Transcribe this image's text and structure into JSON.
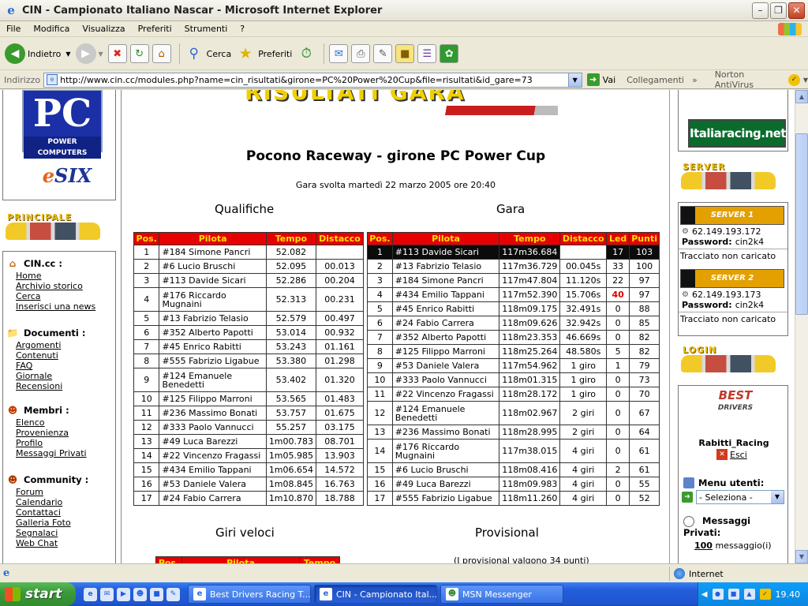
{
  "window": {
    "title": "CIN - Campionato Italiano Nascar - Microsoft Internet Explorer"
  },
  "menu": [
    "File",
    "Modifica",
    "Visualizza",
    "Preferiti",
    "Strumenti",
    "?"
  ],
  "toolbar": {
    "back": "Indietro",
    "search": "Cerca",
    "favorites": "Preferiti"
  },
  "address": {
    "label": "Indirizzo",
    "url": "http://www.cin.cc/modules.php?name=cin_risultati&girone=PC%20Power%20Cup&file=risultati&id_gare=73",
    "go": "Vai",
    "links": "Collegamenti",
    "antivirus": "Norton AntiVirus"
  },
  "left": {
    "pc_logo_big": "PC",
    "pc_logo_small": "POWER COMPUTERS",
    "esix_a": "e",
    "esix_b": "SIX",
    "principale": "PRINCIPALE",
    "sections": [
      {
        "title": "CIN.cc :",
        "icon": "home-icon",
        "links": [
          "Home",
          "Archivio storico",
          "Cerca",
          "Inserisci una news"
        ]
      },
      {
        "title": "Documenti :",
        "icon": "folder-icon",
        "links": [
          "Argomenti",
          "Contenuti",
          "FAQ",
          "Giornale",
          "Recensioni"
        ]
      },
      {
        "title": "Membri :",
        "icon": "users-icon",
        "links": [
          "Elenco",
          "Provenienza",
          "Profilo",
          "Messaggi Privati"
        ]
      },
      {
        "title": "Community :",
        "icon": "community-icon",
        "links": [
          "Forum",
          "Calendario",
          "Contattaci",
          "Galleria Foto",
          "Segnalaci",
          "Web Chat"
        ]
      }
    ]
  },
  "main": {
    "banner": "RISULTATI GARA",
    "race_title": "Pocono Raceway - girone PC Power Cup",
    "race_date": "Gara svolta martedì 22 marzo 2005 ore 20:40",
    "qual_title": "Qualifiche",
    "race_section": "Gara",
    "fast_laps": "Giri veloci",
    "provisional": "Provisional",
    "provisional_note": "(I provisional valgono 34 punti)",
    "qual_headers": [
      "Pos.",
      "Pilota",
      "Tempo",
      "Distacco"
    ],
    "qual_rows": [
      [
        "1",
        "#184 Simone Pancri",
        "52.082",
        ""
      ],
      [
        "2",
        "#6 Lucio Bruschi",
        "52.095",
        "00.013"
      ],
      [
        "3",
        "#113 Davide Sicari",
        "52.286",
        "00.204"
      ],
      [
        "4",
        "#176 Riccardo Mugnaini",
        "52.313",
        "00.231"
      ],
      [
        "5",
        "#13 Fabrizio Telasio",
        "52.579",
        "00.497"
      ],
      [
        "6",
        "#352 Alberto Papotti",
        "53.014",
        "00.932"
      ],
      [
        "7",
        "#45 Enrico Rabitti",
        "53.243",
        "01.161"
      ],
      [
        "8",
        "#555 Fabrizio Ligabue",
        "53.380",
        "01.298"
      ],
      [
        "9",
        "#124 Emanuele Benedetti",
        "53.402",
        "01.320"
      ],
      [
        "10",
        "#125 Filippo Marroni",
        "53.565",
        "01.483"
      ],
      [
        "11",
        "#236 Massimo Bonati",
        "53.757",
        "01.675"
      ],
      [
        "12",
        "#333 Paolo Vannucci",
        "55.257",
        "03.175"
      ],
      [
        "13",
        "#49 Luca Barezzi",
        "1m00.783",
        "08.701"
      ],
      [
        "14",
        "#22 Vincenzo Fragassi",
        "1m05.985",
        "13.903"
      ],
      [
        "15",
        "#434 Emilio Tappani",
        "1m06.654",
        "14.572"
      ],
      [
        "16",
        "#53 Daniele Valera",
        "1m08.845",
        "16.763"
      ],
      [
        "17",
        "#24 Fabio Carrera",
        "1m10.870",
        "18.788"
      ]
    ],
    "race_headers": [
      "Pos.",
      "Pilota",
      "Tempo",
      "Distacco",
      "Led",
      "Punti"
    ],
    "race_rows": [
      [
        "1",
        "#113 Davide Sicari",
        "117m36.684",
        "",
        "17",
        "103"
      ],
      [
        "2",
        "#13 Fabrizio Telasio",
        "117m36.729",
        "00.045s",
        "33",
        "100"
      ],
      [
        "3",
        "#184 Simone Pancri",
        "117m47.804",
        "11.120s",
        "22",
        "97"
      ],
      [
        "4",
        "#434 Emilio Tappani",
        "117m52.390",
        "15.706s",
        "40",
        "97"
      ],
      [
        "5",
        "#45 Enrico Rabitti",
        "118m09.175",
        "32.491s",
        "0",
        "88"
      ],
      [
        "6",
        "#24 Fabio Carrera",
        "118m09.626",
        "32.942s",
        "0",
        "85"
      ],
      [
        "7",
        "#352 Alberto Papotti",
        "118m23.353",
        "46.669s",
        "0",
        "82"
      ],
      [
        "8",
        "#125 Filippo Marroni",
        "118m25.264",
        "48.580s",
        "5",
        "82"
      ],
      [
        "9",
        "#53 Daniele Valera",
        "117m54.962",
        "1 giro",
        "1",
        "79"
      ],
      [
        "10",
        "#333 Paolo Vannucci",
        "118m01.315",
        "1 giro",
        "0",
        "73"
      ],
      [
        "11",
        "#22 Vincenzo Fragassi",
        "118m28.172",
        "1 giro",
        "0",
        "70"
      ],
      [
        "12",
        "#124 Emanuele Benedetti",
        "118m02.967",
        "2 giri",
        "0",
        "67"
      ],
      [
        "13",
        "#236 Massimo Bonati",
        "118m28.995",
        "2 giri",
        "0",
        "64"
      ],
      [
        "14",
        "#176 Riccardo Mugnaini",
        "117m38.015",
        "4 giri",
        "0",
        "61"
      ],
      [
        "15",
        "#6 Lucio Bruschi",
        "118m08.416",
        "4 giri",
        "2",
        "61"
      ],
      [
        "16",
        "#49 Luca Barezzi",
        "118m09.983",
        "4 giri",
        "0",
        "55"
      ],
      [
        "17",
        "#555 Fabrizio Ligabue",
        "118m11.260",
        "4 giri",
        "0",
        "52"
      ]
    ],
    "fast_headers": [
      "Pos.",
      "Pilota",
      "Tempo"
    ]
  },
  "right": {
    "iracing": "Italiaracing.net",
    "server_label": "SERVER",
    "servers": [
      {
        "name": "SERVER 1",
        "ip": "62.149.193.172",
        "pwd_label": "Password:",
        "pwd": "cin2k4",
        "track": "Tracciato non caricato"
      },
      {
        "name": "SERVER 2",
        "ip": "62.149.193.173",
        "pwd_label": "Password:",
        "pwd": "cin2k4",
        "track": "Tracciato non caricato"
      }
    ],
    "login_label": "LOGIN",
    "best_a": "BEST",
    "best_b": "DRIVERS",
    "user": "Rabitti_Racing",
    "exit": "Esci",
    "menu_utenti": "Menu utenti:",
    "select": "- Seleziona -",
    "messages_title": "Messaggi Privati:",
    "messages_count": "100",
    "messages_suffix": "messaggio(i)"
  },
  "status": {
    "zone": "Internet"
  },
  "taskbar": {
    "start": "start",
    "tasks": [
      "Best Drivers Racing T...",
      "CIN - Campionato Ital...",
      "MSN Messenger"
    ],
    "clock": "19.40"
  },
  "colors": {
    "table_header_bg": "#e60000",
    "table_header_fg": "#ffe400",
    "highlight": "#0b0b0b"
  }
}
